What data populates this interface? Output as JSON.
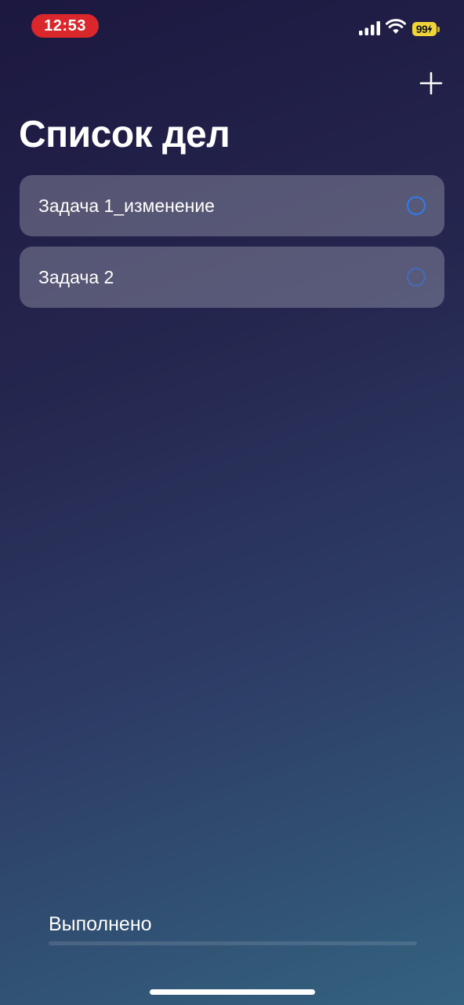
{
  "status_bar": {
    "time": "12:53",
    "battery": "99",
    "icons": [
      "signal-icon",
      "wifi-icon",
      "battery-charging-icon"
    ]
  },
  "header": {
    "add_icon": "plus-icon",
    "title": "Список дел"
  },
  "tasks": [
    {
      "title": "Задача 1_изменение",
      "completed": false
    },
    {
      "title": "Задача 2",
      "completed": false
    }
  ],
  "completed_section": {
    "label": "Выполнено"
  },
  "colors": {
    "accent": "#2f7df3",
    "time_pill": "#d9272b",
    "battery": "#f0d53a",
    "background_top": "#1c1840",
    "background_bottom": "#34627f"
  }
}
